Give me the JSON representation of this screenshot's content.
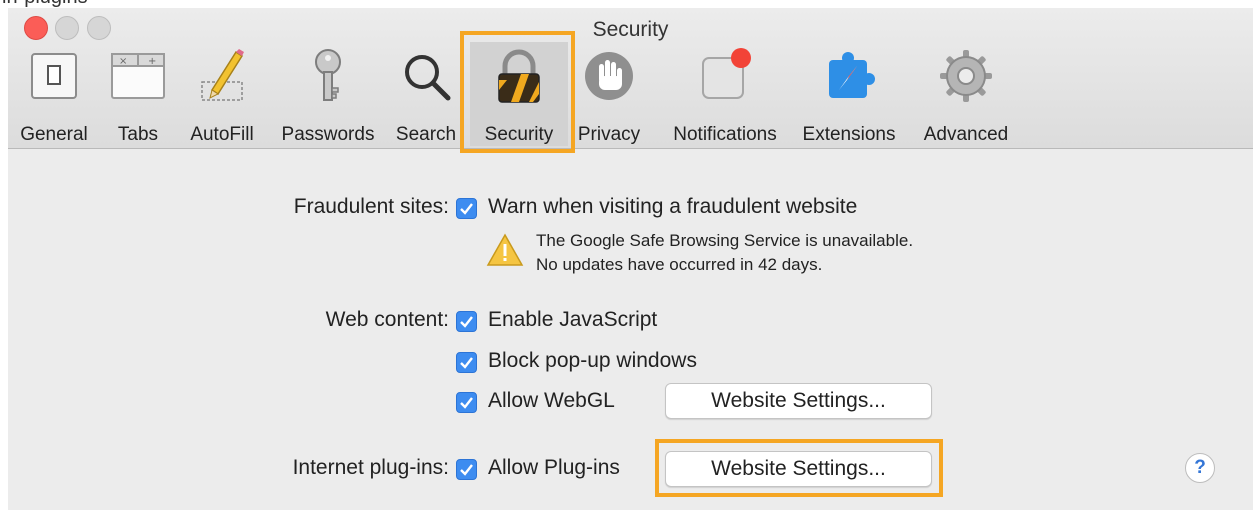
{
  "page_fragment": "ln-plugins",
  "window": {
    "title": "Security"
  },
  "toolbar": {
    "tabs": [
      {
        "label": "General",
        "icon": "general-icon"
      },
      {
        "label": "Tabs",
        "icon": "tabs-icon"
      },
      {
        "label": "AutoFill",
        "icon": "autofill-pencil-icon"
      },
      {
        "label": "Passwords",
        "icon": "key-icon"
      },
      {
        "label": "Search",
        "icon": "magnifier-icon"
      },
      {
        "label": "Security",
        "icon": "lock-icon",
        "selected": true
      },
      {
        "label": "Privacy",
        "icon": "hand-icon"
      },
      {
        "label": "Notifications",
        "icon": "notification-badge-icon"
      },
      {
        "label": "Extensions",
        "icon": "puzzle-compass-icon"
      },
      {
        "label": "Advanced",
        "icon": "gear-icon"
      }
    ]
  },
  "fraud": {
    "label": "Fraudulent sites:",
    "option": "Warn when visiting a fraudulent website",
    "checked": true,
    "warning_line1": "The Google Safe Browsing Service is unavailable.",
    "warning_line2": "No updates have occurred in 42 days."
  },
  "web_content": {
    "label": "Web content:",
    "js": "Enable JavaScript",
    "popups": "Block pop-up windows",
    "webgl": "Allow WebGL",
    "webgl_button": "Website Settings..."
  },
  "plugins": {
    "label": "Internet plug-ins:",
    "option": "Allow Plug-ins",
    "button": "Website Settings..."
  },
  "help": {
    "label": "?"
  },
  "colors": {
    "highlight": "#f5a623",
    "checkbox": "#3d8cf0",
    "close": "#fb5d57"
  }
}
